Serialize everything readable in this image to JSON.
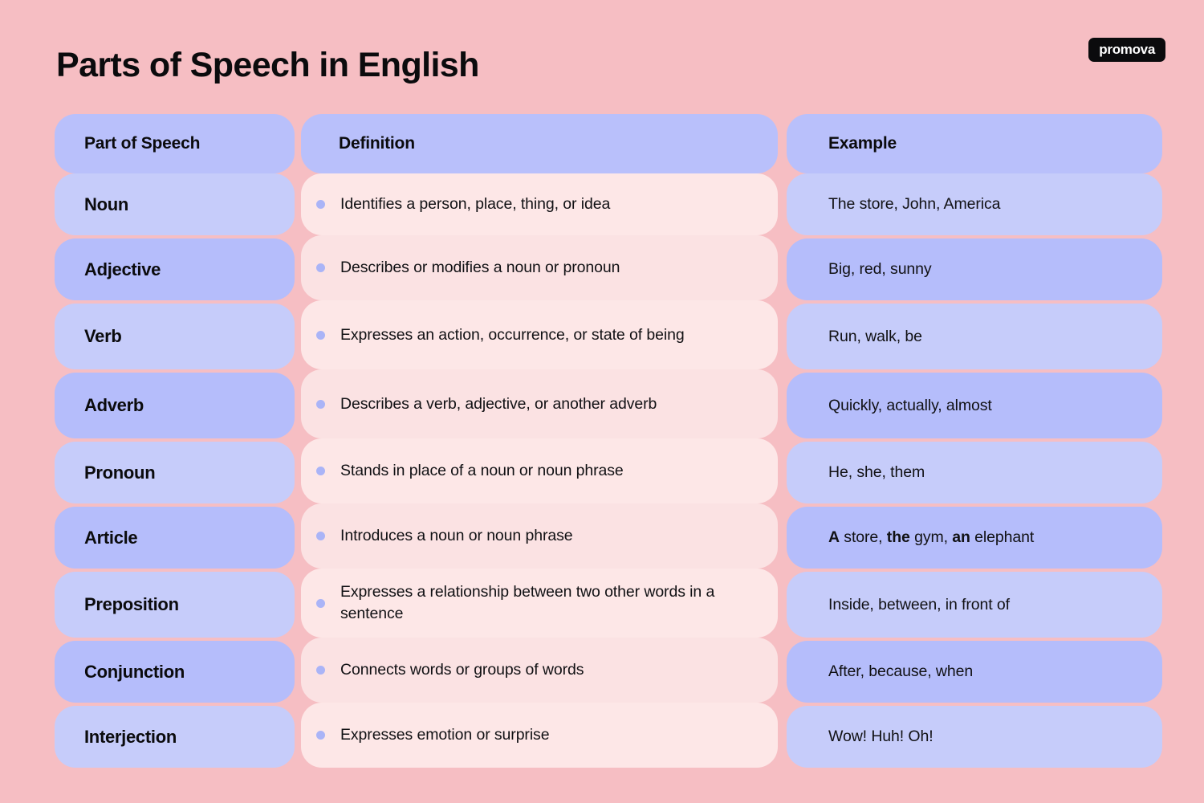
{
  "header": {
    "title": "Parts of Speech in English",
    "brand": "promova"
  },
  "table": {
    "columns": [
      {
        "key": "term",
        "label": "Part of Speech"
      },
      {
        "key": "definition",
        "label": "Definition"
      },
      {
        "key": "example",
        "label": "Example"
      }
    ],
    "rows": [
      {
        "term": "Noun",
        "definition": "Identifies a person, place, thing, or idea",
        "example": "The store, John, America",
        "example_html": "The store, John, America"
      },
      {
        "term": "Adjective",
        "definition": "Describes or modifies a noun or pronoun",
        "example": "Big, red, sunny",
        "example_html": "Big, red, sunny"
      },
      {
        "term": "Verb",
        "definition": "Expresses an action, occurrence, or state of being",
        "example": "Run, walk, be",
        "example_html": "Run, walk, be"
      },
      {
        "term": "Adverb",
        "definition": "Describes a verb, adjective, or another adverb",
        "example": "Quickly, actually, almost",
        "example_html": "Quickly, actually, almost"
      },
      {
        "term": "Pronoun",
        "definition": "Stands in place of a noun or noun phrase",
        "example": "He, she, them",
        "example_html": "He, she, them"
      },
      {
        "term": "Article",
        "definition": "Introduces a noun or noun phrase",
        "example": "A store, the gym, an elephant",
        "example_html": "<b>A</b> store, <b>the</b> gym, <b>an</b> elephant"
      },
      {
        "term": "Preposition",
        "definition": "Expresses a relationship between two other words in a sentence",
        "example": "Inside, between, in front of",
        "example_html": "Inside, between, in front of"
      },
      {
        "term": "Conjunction",
        "definition": "Connects words or groups of words",
        "example": "After, because, when",
        "example_html": "After, because, when"
      },
      {
        "term": "Interjection",
        "definition": "Expresses emotion or surprise",
        "example": "Wow! Huh! Oh!",
        "example_html": "Wow! Huh! Oh!"
      }
    ]
  },
  "colors": {
    "page_background": "#f6bec3",
    "header_cell": "#b9c0fb",
    "term_cell_odd": "#c6ccfa",
    "term_cell_even": "#b5bdfb",
    "definition_cell_odd": "#fde7e7",
    "definition_cell_even": "#fbe2e3",
    "bullet": "#aab4f7",
    "text": "#0b0b0d",
    "brand_background": "#0b0b0d",
    "brand_text": "#ffffff"
  }
}
